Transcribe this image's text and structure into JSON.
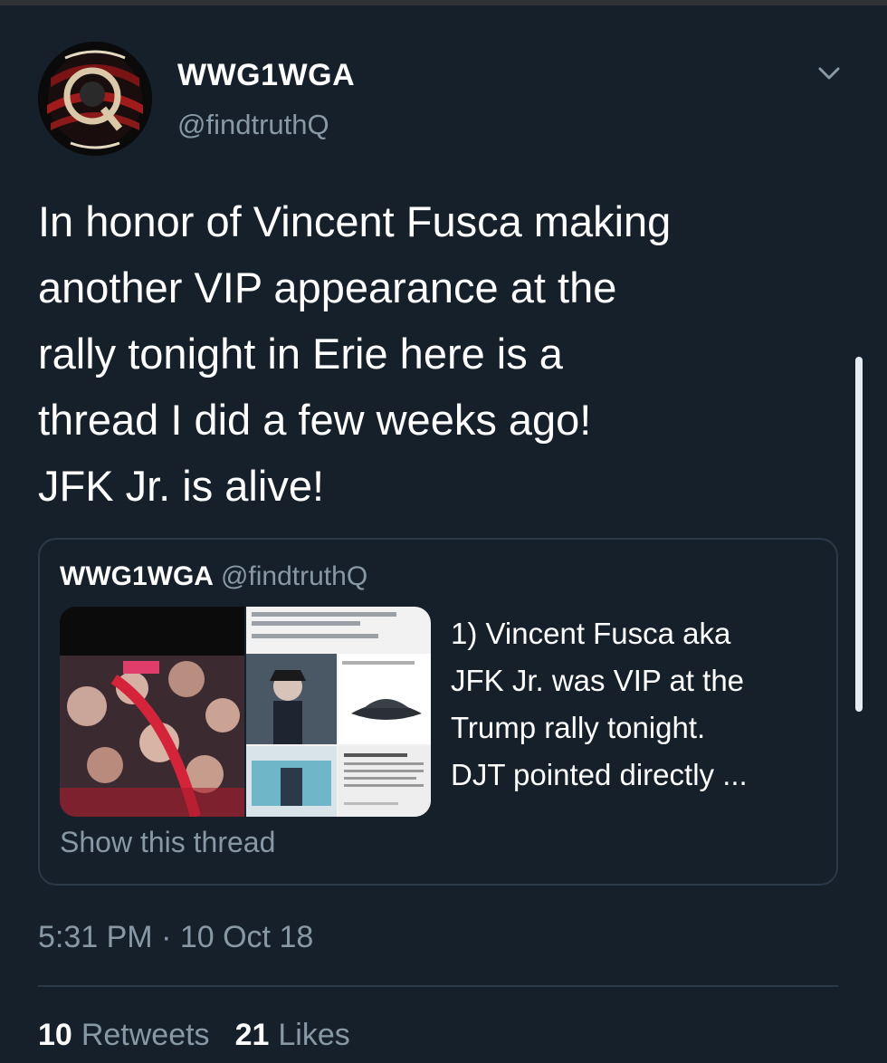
{
  "colors": {
    "background": "#15202b",
    "text_primary": "#ffffff",
    "text_secondary": "#8899a6",
    "border": "#2b3a48"
  },
  "tweet": {
    "author_name": "WWG1WGA",
    "author_handle": "@findtruthQ",
    "text": "In honor of Vincent Fusca making\nanother VIP appearance at the\nrally tonight in Erie here is a\nthread I did a few weeks ago!\nJFK Jr. is alive!",
    "timestamp": "5:31 PM · 10 Oct 18",
    "retweets_count": "10",
    "retweets_label": "Retweets",
    "likes_count": "21",
    "likes_label": "Likes",
    "menu_icon": "chevron-down-icon"
  },
  "quoted_tweet": {
    "author_name": "WWG1WGA",
    "author_handle": "@findtruthQ",
    "text": "1) Vincent Fusca aka\nJFK Jr. was VIP at the\nTrump rally tonight.\nDJT pointed directly ...",
    "show_thread_label": "Show this thread"
  }
}
